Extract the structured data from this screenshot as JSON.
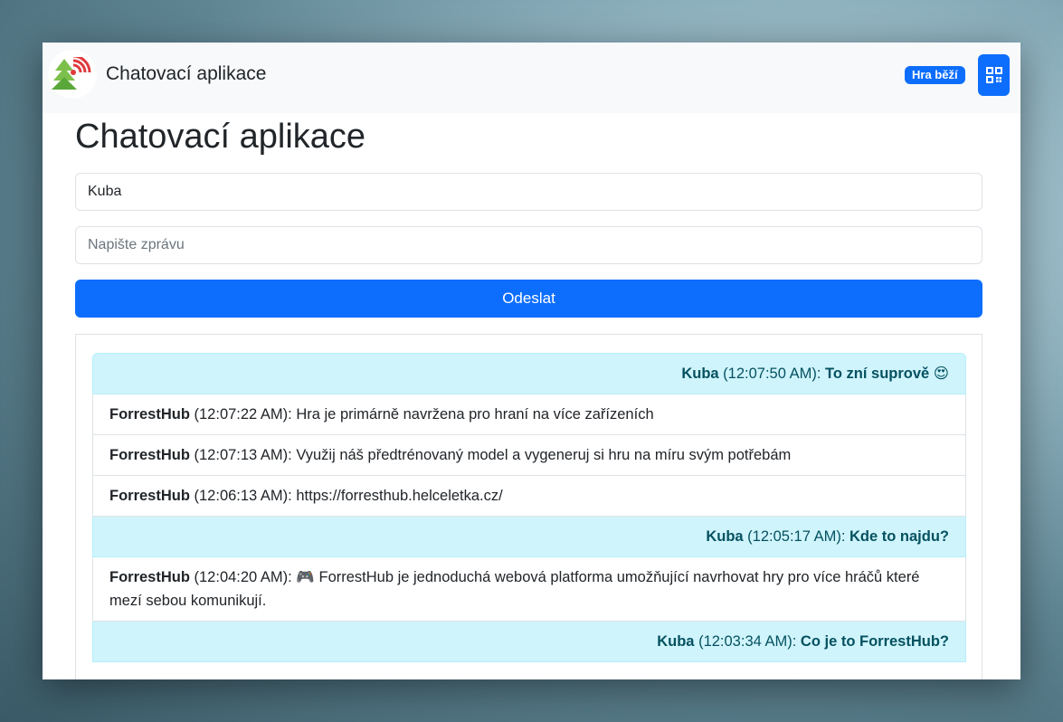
{
  "navbar": {
    "brand": "Chatovací aplikace",
    "status_badge": "Hra běží"
  },
  "page": {
    "title": "Chatovací aplikace"
  },
  "form": {
    "name_value": "Kuba",
    "message_placeholder": "Napište zprávu",
    "send_label": "Odeslat"
  },
  "colors": {
    "primary": "#0d6efd",
    "own_message_bg": "#cff4fc",
    "own_message_text": "#055160"
  },
  "messages": [
    {
      "author": "Kuba",
      "time": "(12:07:50 AM):",
      "text": "To zní suprově",
      "emoji": "😍",
      "mine": true
    },
    {
      "author": "ForrestHub",
      "time": "(12:07:22 AM):",
      "text": "Hra je primárně navržena pro hraní na více zařízeních",
      "mine": false
    },
    {
      "author": "ForrestHub",
      "time": "(12:07:13 AM):",
      "text": "Využij náš předtrénovaný model a vygeneruj si hru na míru svým potřebám",
      "mine": false
    },
    {
      "author": "ForrestHub",
      "time": "(12:06:13 AM):",
      "text": "https://forresthub.helceletka.cz/",
      "mine": false
    },
    {
      "author": "Kuba",
      "time": "(12:05:17 AM):",
      "text": "Kde to najdu?",
      "mine": true
    },
    {
      "author": "ForrestHub",
      "time": "(12:04:20 AM):",
      "emoji": "🎮",
      "text": "ForrestHub je jednoduchá webová platforma umožňující navrhovat hry pro více hráčů které mezí sebou komunikují.",
      "mine": false
    },
    {
      "author": "Kuba",
      "time": "(12:03:34 AM):",
      "text": "Co je to ForrestHub?",
      "mine": true
    }
  ]
}
